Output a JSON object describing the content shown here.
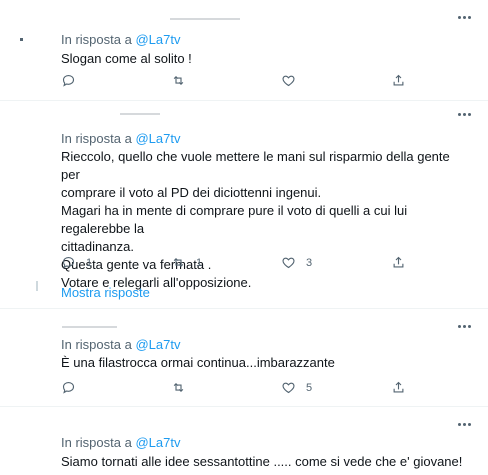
{
  "tweets": [
    {
      "reply_prefix": "In risposta a",
      "reply_handle": "@La7tv",
      "text_lines": [
        "Slogan come al solito !"
      ],
      "replies": "",
      "retweets": "",
      "likes": ""
    },
    {
      "reply_prefix": "In risposta a",
      "reply_handle": "@La7tv",
      "text_lines": [
        "Rieccolo, quello che vuole mettere le mani sul risparmio della gente per",
        "comprare il voto al PD dei diciottenni ingenui.",
        "Magari ha in mente di comprare pure il voto di quelli a cui lui regalerebbe la",
        "cittadinanza.",
        "Questa gente va fermata .",
        "Votare e relegarli all'opposizione."
      ],
      "replies": "1",
      "retweets": "1",
      "likes": "3",
      "show_replies": "Mostra risposte"
    },
    {
      "reply_prefix": "In risposta a",
      "reply_handle": "@La7tv",
      "text_lines": [
        "È una filastrocca ormai continua...imbarazzante"
      ],
      "replies": "",
      "retweets": "",
      "likes": "5"
    },
    {
      "reply_prefix": "In risposta a",
      "reply_handle": "@La7tv",
      "text_lines": [
        "Siamo tornati alle idee sessantottine ..... come si vede che e' giovane!"
      ]
    }
  ],
  "icons": {
    "reply": "reply-icon",
    "retweet": "retweet-icon",
    "like": "heart-icon",
    "share": "share-icon",
    "more": "more-icon"
  },
  "colors": {
    "accent": "#1d9bf0",
    "muted": "#536471",
    "text": "#0f1419"
  }
}
